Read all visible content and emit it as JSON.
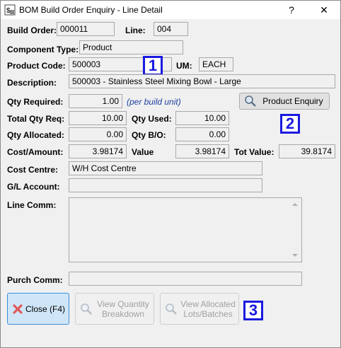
{
  "window": {
    "title": "BOM Build Order Enquiry - Line Detail",
    "help_label": "?",
    "close_label": "✕"
  },
  "form": {
    "build_order": {
      "label": "Build Order:",
      "value": "000011"
    },
    "line": {
      "label": "Line:",
      "value": "004"
    },
    "component_type": {
      "label": "Component Type:",
      "value": "Product"
    },
    "product_code": {
      "label": "Product Code:",
      "value": "500003"
    },
    "um": {
      "label": "UM:",
      "value": "EACH"
    },
    "description": {
      "label": "Description:",
      "value": "500003 - Stainless Steel Mixing Bowl - Large"
    },
    "qty_required": {
      "label": "Qty Required:",
      "value": "1.00",
      "hint": "(per build unit)"
    },
    "total_qty_req": {
      "label": "Total Qty Req:",
      "value": "10.00"
    },
    "qty_used": {
      "label": "Qty Used:",
      "value": "10.00"
    },
    "qty_allocated": {
      "label": "Qty Allocated:",
      "value": "0.00"
    },
    "qty_bo": {
      "label": "Qty B/O:",
      "value": "0.00"
    },
    "cost_amount": {
      "label": "Cost/Amount:",
      "value": "3.98174"
    },
    "value": {
      "label": "Value",
      "value": "3.98174"
    },
    "tot_value": {
      "label": "Tot Value:",
      "value": "39.8174"
    },
    "cost_centre": {
      "label": "Cost Centre:",
      "value": "W/H Cost Centre"
    },
    "gl_account": {
      "label": "G/L Account:",
      "value": ""
    },
    "line_comm": {
      "label": "Line Comm:",
      "value": ""
    },
    "purch_comm": {
      "label": "Purch Comm:",
      "value": ""
    }
  },
  "buttons": {
    "product_enquiry": "Product Enquiry",
    "close": "Close (F4)",
    "view_qty_line1": "View Quantity",
    "view_qty_line2": "Breakdown",
    "view_alloc_line1": "View Allocated",
    "view_alloc_line2": "Lots/Batches"
  },
  "badges": [
    "1",
    "2",
    "3"
  ],
  "colors": {
    "badge": "#1a1ae0",
    "hint": "#1f3fa0",
    "close_icon": "#e05a5a"
  },
  "icons": [
    "bom-app-icon",
    "magnifier-icon",
    "close-x-icon"
  ]
}
